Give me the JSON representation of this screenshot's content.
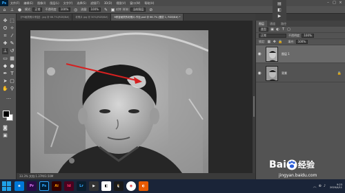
{
  "menubar": {
    "logo": "Ps",
    "items": [
      "文件(F)",
      "编辑(E)",
      "图像(I)",
      "图层(L)",
      "文字(Y)",
      "选择(S)",
      "滤镜(T)",
      "3D(D)",
      "视图(V)",
      "窗口(W)",
      "帮助(H)"
    ]
  },
  "optionsbar": {
    "mode_label": "模式:",
    "mode_value": "正常",
    "opacity_label": "不透明度:",
    "opacity_value": "100%",
    "flow_label": "流量:",
    "flow_value": "100%",
    "aligned_label": "对齐",
    "sample_label": "样本:",
    "sample_value": "当前图层"
  },
  "document": {
    "tabs": [
      {
        "label": "【PS破损照片修复】.jpg @ 66.7%(RGB/8#)"
      },
      {
        "label": "老照片.jpg @ 50%(RGB/8#)"
      },
      {
        "label": "6修复破损的老照片-作业.psd @ 66.7% (图层 1, RGB/8#) *"
      }
    ],
    "status": "33.3%   文档:1.37M/3.50M"
  },
  "layers_panel": {
    "tabs": [
      "图层",
      "通道",
      "路径"
    ],
    "kind_label": "类型",
    "blend_mode": "正常",
    "opacity_label": "不透明度:",
    "opacity_value": "100%",
    "lock_label": "锁定:",
    "fill_label": "填充:",
    "fill_value": "100%",
    "layers": [
      {
        "name": "图层 1",
        "selected": true
      },
      {
        "name": "背景",
        "selected": false,
        "locked": true
      }
    ]
  },
  "taskbar": {
    "apps": [
      {
        "icon": "pr-icon",
        "label": "Pr",
        "color": "#2a0b47"
      },
      {
        "icon": "ps-icon",
        "label": "Ps",
        "color": "#001d34"
      },
      {
        "icon": "ai-icon",
        "label": "Ai",
        "color": "#330000"
      },
      {
        "icon": "id-icon",
        "label": "Id",
        "color": "#49021f"
      },
      {
        "icon": "lr-icon",
        "label": "Lr",
        "color": "#0a1e2d"
      }
    ],
    "time": "9:23",
    "date": "2020/4/11"
  },
  "watermark": {
    "brand_a": "Bai",
    "brand_b": "经验",
    "url": "jingyan.baidu.com"
  },
  "colors": {
    "accent_arrow": "#d62020",
    "panel_bg": "#535353",
    "doc_bg": "#282828"
  }
}
